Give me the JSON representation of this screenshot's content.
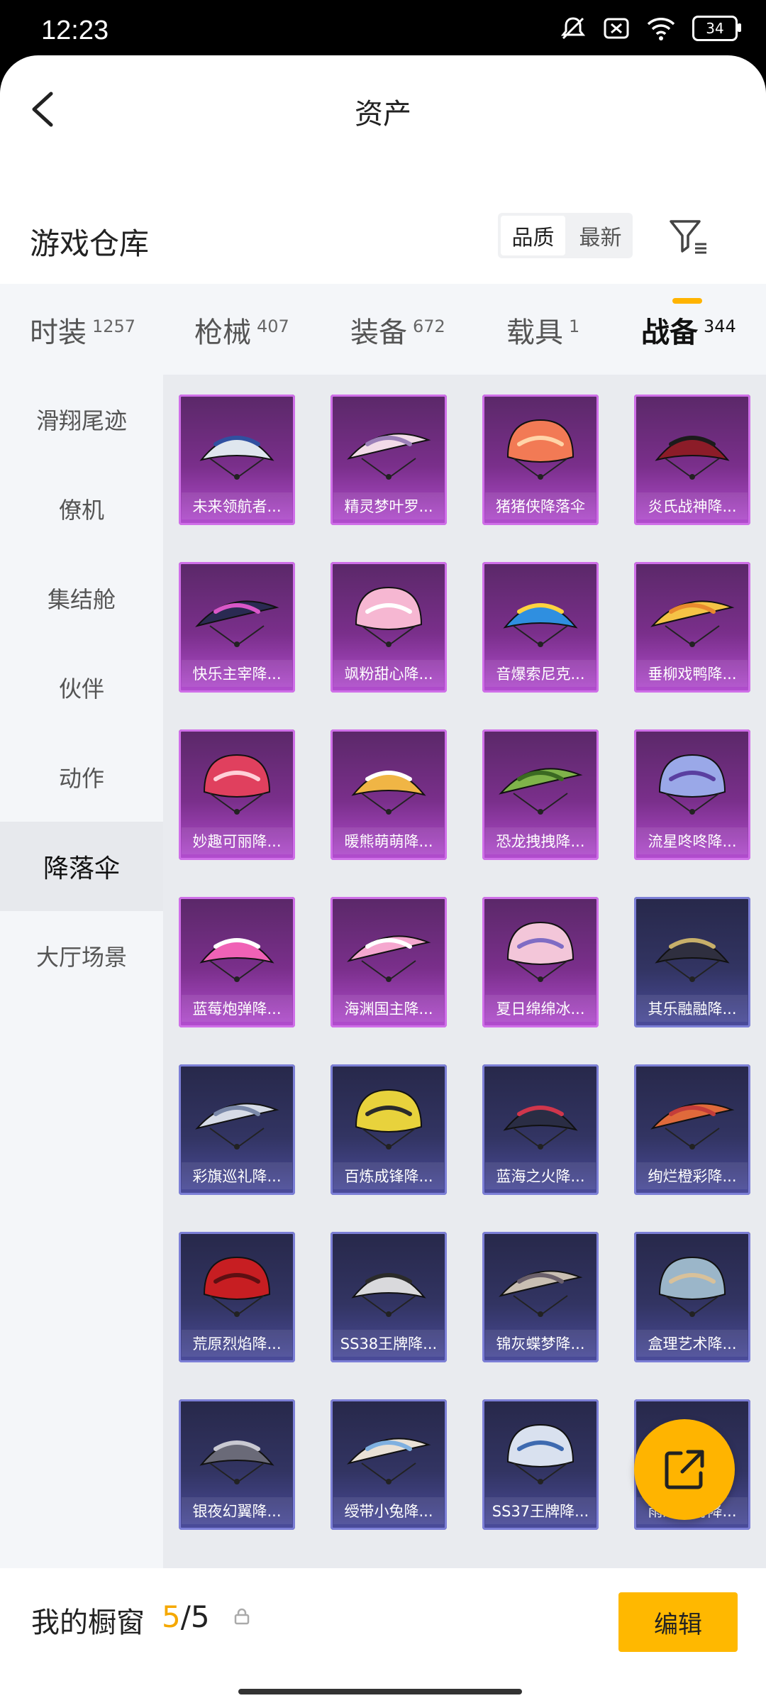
{
  "status": {
    "time": "12:23",
    "battery": "34"
  },
  "header": {
    "title": "资产"
  },
  "warehouse": {
    "title": "游戏仓库",
    "sort": [
      "品质",
      "最新"
    ]
  },
  "tabs": [
    {
      "label": "时装",
      "count": "1257"
    },
    {
      "label": "枪械",
      "count": "407"
    },
    {
      "label": "装备",
      "count": "672"
    },
    {
      "label": "载具",
      "count": "1"
    },
    {
      "label": "战备",
      "count": "344"
    }
  ],
  "sidebar": [
    "滑翔尾迹",
    "僚机",
    "集结舱",
    "伙伴",
    "动作",
    "降落伞",
    "大厅场景"
  ],
  "items": [
    {
      "name": "未来领航者...",
      "rarity": "pink",
      "color": "#dfe6ee",
      "accent": "#3050a0"
    },
    {
      "name": "精灵梦叶罗...",
      "rarity": "pink",
      "color": "#f2dbe8",
      "accent": "#9b7fb8"
    },
    {
      "name": "猪猪侠降落伞",
      "rarity": "pink",
      "color": "#f27a55",
      "accent": "#ffd4a8"
    },
    {
      "name": "炎氏战神降...",
      "rarity": "pink",
      "color": "#8c1c28",
      "accent": "#1b1b1b"
    },
    {
      "name": "快乐主宰降...",
      "rarity": "pink",
      "color": "#2a2a52",
      "accent": "#d957c8"
    },
    {
      "name": "飒粉甜心降...",
      "rarity": "pink",
      "color": "#f6b7d2",
      "accent": "#ffffff"
    },
    {
      "name": "音爆索尼克...",
      "rarity": "pink",
      "color": "#2f8fe0",
      "accent": "#ffd23f"
    },
    {
      "name": "垂柳戏鸭降...",
      "rarity": "pink",
      "color": "#f5c346",
      "accent": "#e88a2e"
    },
    {
      "name": "妙趣可丽降...",
      "rarity": "pink",
      "color": "#e0405e",
      "accent": "#ffd0d8"
    },
    {
      "name": "暖熊萌萌降...",
      "rarity": "pink",
      "color": "#f0b545",
      "accent": "#ffffff"
    },
    {
      "name": "恐龙拽拽降...",
      "rarity": "pink",
      "color": "#7fb34a",
      "accent": "#3b6a22"
    },
    {
      "name": "流星咚咚降...",
      "rarity": "pink",
      "color": "#9aa8e8",
      "accent": "#5a3fa0"
    },
    {
      "name": "蓝莓炮弹降...",
      "rarity": "pink",
      "color": "#f062b6",
      "accent": "#ffffff"
    },
    {
      "name": "海渊国主降...",
      "rarity": "pink",
      "color": "#f5a7cf",
      "accent": "#ffffff"
    },
    {
      "name": "夏日绵绵冰...",
      "rarity": "pink",
      "color": "#f3c6d9",
      "accent": "#7f6cc4"
    },
    {
      "name": "其乐融融降...",
      "rarity": "blue",
      "color": "#2f2f3f",
      "accent": "#c8b06a"
    },
    {
      "name": "彩旗巡礼降...",
      "rarity": "blue",
      "color": "#d6dbe6",
      "accent": "#7a88a8"
    },
    {
      "name": "百炼成锋降...",
      "rarity": "blue",
      "color": "#e8d23c",
      "accent": "#2b2b2b"
    },
    {
      "name": "蓝海之火降...",
      "rarity": "blue",
      "color": "#2a2d44",
      "accent": "#d0364c"
    },
    {
      "name": "绚烂橙彩降...",
      "rarity": "blue",
      "color": "#e06a3b",
      "accent": "#c43d3a"
    },
    {
      "name": "荒原烈焰降...",
      "rarity": "blue",
      "color": "#c71e22",
      "accent": "#5e0f12"
    },
    {
      "name": "SS38王牌降...",
      "rarity": "blue",
      "color": "#d9d9dc",
      "accent": "#2b2b2b"
    },
    {
      "name": "锦灰蝶梦降...",
      "rarity": "blue",
      "color": "#c9bfb3",
      "accent": "#6a5f6a"
    },
    {
      "name": "盒理艺术降...",
      "rarity": "blue",
      "color": "#9bb6c9",
      "accent": "#d8c19a"
    },
    {
      "name": "银夜幻翼降...",
      "rarity": "blue",
      "color": "#6a6a78",
      "accent": "#c9c9d2"
    },
    {
      "name": "绶带小兔降...",
      "rarity": "blue",
      "color": "#e9e1d6",
      "accent": "#7fb0e0"
    },
    {
      "name": "SS37王牌降...",
      "rarity": "blue",
      "color": "#d9e1ef",
      "accent": "#3e6ab0"
    },
    {
      "name": "雨过天青降...",
      "rarity": "blue",
      "color": "#a7c0d9",
      "accent": "#ffffff"
    }
  ],
  "footer": {
    "label": "我的橱窗",
    "current": "5",
    "sep": "/",
    "total": "5",
    "edit": "编辑"
  }
}
